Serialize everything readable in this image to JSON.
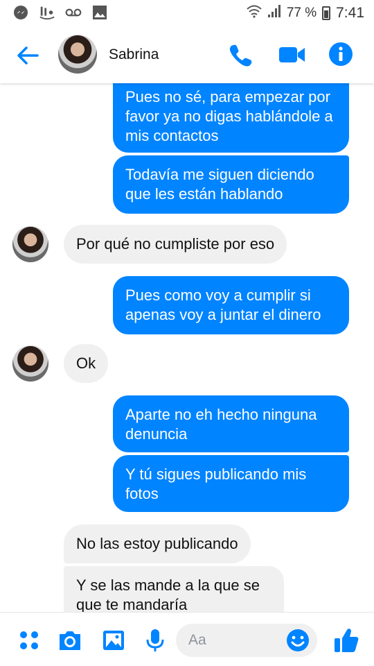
{
  "status_bar": {
    "battery_percent": "77 %",
    "time": "7:41"
  },
  "header": {
    "contact_name": "Sabrina"
  },
  "messages": [
    {
      "direction": "out",
      "text": "Pues no sé, para empezar por favor ya no digas hablándole a mis contactos"
    },
    {
      "direction": "out",
      "text": "Todavía me siguen diciendo que les están hablando"
    },
    {
      "direction": "in",
      "text": "Por qué no cumpliste por eso"
    },
    {
      "direction": "out",
      "text": "Pues como voy a cumplir si apenas voy a juntar el dinero"
    },
    {
      "direction": "in",
      "text": "Ok"
    },
    {
      "direction": "out",
      "text": "Aparte no eh hecho ninguna denuncia"
    },
    {
      "direction": "out",
      "text": "Y tú sigues publicando mis fotos"
    },
    {
      "direction": "in",
      "text": "No las estoy publicando"
    },
    {
      "direction": "in",
      "text": "Y se las mande a la que se que te mandaría"
    }
  ],
  "composer": {
    "placeholder": "Aa"
  },
  "colors": {
    "accent": "#0084ff",
    "incoming_bubble": "#f1f0f0"
  },
  "icons": [
    "messenger-icon",
    "voicemail-icon",
    "gallery-icon",
    "wifi-icon",
    "signal-icon",
    "battery-icon",
    "back-arrow-icon",
    "phone-icon",
    "video-icon",
    "info-icon",
    "apps-icon",
    "camera-icon",
    "image-icon",
    "microphone-icon",
    "emoji-icon",
    "thumbs-up-icon"
  ]
}
